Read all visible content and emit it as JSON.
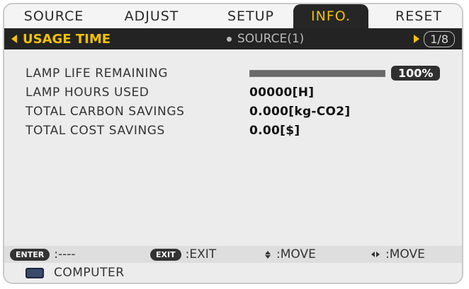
{
  "tabs": [
    {
      "label": "SOURCE",
      "active": false
    },
    {
      "label": "ADJUST",
      "active": false
    },
    {
      "label": "SETUP",
      "active": false
    },
    {
      "label": "INFO.",
      "active": true
    },
    {
      "label": "RESET",
      "active": false
    }
  ],
  "subbar": {
    "current": "USAGE TIME",
    "next": "SOURCE(1)",
    "page": "1/8"
  },
  "rows": [
    {
      "label": "LAMP LIFE REMAINING",
      "value": "100%",
      "progress": 1.0
    },
    {
      "label": "LAMP HOURS USED",
      "value": "00000[H]"
    },
    {
      "label": "TOTAL CARBON SAVINGS",
      "value": "0.000[kg-CO2]"
    },
    {
      "label": "TOTAL COST SAVINGS",
      "value": "0.00[$]"
    }
  ],
  "footer": {
    "enter_key": "ENTER",
    "enter_action": ":----",
    "exit_key": "EXIT",
    "exit_action": ":EXIT",
    "move_updown": ":MOVE",
    "move_leftright": ":MOVE"
  },
  "status": {
    "source_icon": "monitor-icon",
    "source": "COMPUTER"
  },
  "colors": {
    "accent": "#f2c200",
    "header_bg": "#232323",
    "panel_bg": "#ececec"
  }
}
